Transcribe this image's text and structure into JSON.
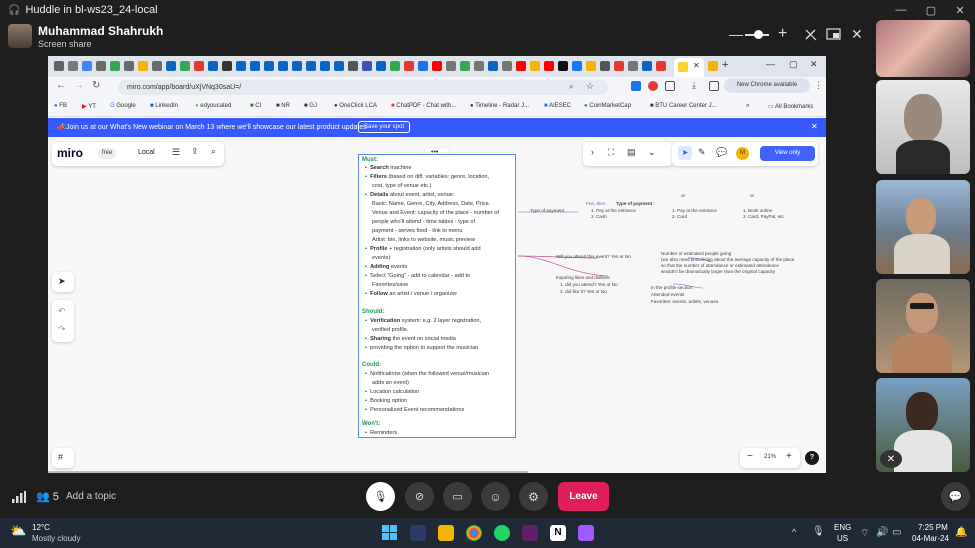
{
  "titlebar": {
    "title": "Huddle in bl-ws23_24-local",
    "minimize": "—",
    "maximize": "▢",
    "close": "✕"
  },
  "huddle": {
    "name": "Muhammad Shahrukh",
    "subtitle": "Screen share",
    "zoom_out": "—",
    "zoom_in": "+",
    "close": "✕"
  },
  "chrome": {
    "url": "miro.com/app/board/uXjVNq30saU=/",
    "bookmarks": [
      "FB",
      "YT",
      "Google",
      "LinkedIn",
      "edyoucated",
      "CI",
      "NR",
      "GJ",
      "OneClick LCA",
      "ChatPDF - Chat with...",
      "Timeline - Radar J...",
      "AIESEC",
      "CoinMarketCap",
      "BTU Career Center J..."
    ],
    "all_bookmarks": "All Bookmarks",
    "update_pill": "New Chrome available"
  },
  "banner": {
    "text": "Join us at our What's New webinar on March 13 where we'll showcase our latest product updates",
    "cta": "Save your spot",
    "close": "✕"
  },
  "miro": {
    "logo": "miro",
    "plan": "free",
    "board_name": "Local",
    "view_only": "View only",
    "zoom": "21%",
    "help": "?",
    "frame_menu": "•••"
  },
  "frame": {
    "must_title": "Must:",
    "must": [
      {
        "b": "Search",
        "t": " machine"
      },
      {
        "b": "Filters",
        "t": " (based on diff. variables: genre, location,"
      },
      {
        "b": "",
        "t": "cost, type of venue etc.)"
      },
      {
        "b": "Details",
        "t": " about event, artist, venue:"
      },
      {
        "b": "",
        "t": "Basic: Name, Genre, City, Address, Date, Price."
      },
      {
        "b": "",
        "t": "Venue and Event: capacity of the place - number of"
      },
      {
        "b": "",
        "t": "people who'll attend - time tables - type of"
      },
      {
        "b": "",
        "t": "payment - serves food - link to menu"
      },
      {
        "b": "",
        "t": "Artist: bio, links to website, music preview"
      },
      {
        "b": "Profile",
        "t": " + registration (only artists should add"
      },
      {
        "b": "",
        "t": "events)"
      },
      {
        "b": "Adding",
        "t": " events"
      },
      {
        "b": "",
        "t": "Select \"Going\" - add to calendar - add to"
      },
      {
        "b": "",
        "t": "Favorites/save"
      },
      {
        "b": "Follow",
        "t": " an artist / venue / organizer"
      }
    ],
    "should_title": "Should:",
    "should": [
      {
        "b": "Verification",
        "t": " system: e.g. 2 layer registration,"
      },
      {
        "b": "",
        "t": "verified profile."
      },
      {
        "b": "Sharing",
        "t": " the event on social media"
      },
      {
        "b": "",
        "t": "providing the option to support the musician"
      }
    ],
    "could_title": "Could:",
    "could": [
      "Notifications (when the followed venue/musician",
      "adds an event)",
      "Location calculation",
      "Booking option",
      "Personalized Event recommendations"
    ],
    "wont_title": "Won't:",
    "wont": [
      "Reminders"
    ]
  },
  "mindmap": {
    "type_payment": "Type of payment",
    "fee": "Fee, then",
    "type_payment2": "Type of payment :",
    "pay1": "1. Pay at the entrance",
    "pay2": "2. Cash",
    "or1": "or",
    "or2": "or",
    "opt_b1": "1. Pay at the entrance",
    "opt_b2": "2. Card",
    "opt_c1": "1. Book online",
    "opt_c2": "2. Card, PayPal, etc",
    "attend_q": "Will you attend this event? Yes or No",
    "estimate1": "Number of estimated people going",
    "estimate2": "(we also need knowledge about the average capacity of the place",
    "estimate3": "so that the number of attendance or estimated attendance",
    "estimate4": "wouldn't be dramatically larger than the original capacity",
    "likes_q": "Inquiring likes and dislikes:",
    "likes1": "1. did you attend?   Yes or No",
    "likes2": "2. did like it?       Yes or No",
    "profile1": "In the profile section:",
    "profile2": "Attended events",
    "profile3": "Favorites: events, artists, venues"
  },
  "controls": {
    "participants": "5",
    "add_topic": "Add a topic",
    "leave": "Leave"
  },
  "taskbar": {
    "temp": "12°C",
    "weather": "Mostly cloudy",
    "lang1": "ENG",
    "lang2": "US",
    "time": "7:25 PM",
    "date": "04-Mar-24"
  }
}
